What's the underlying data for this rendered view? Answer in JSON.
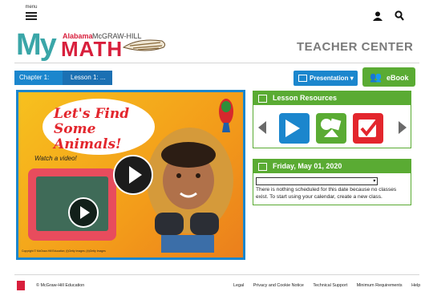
{
  "topbar": {
    "menu_label": "menu",
    "user_icon": "user-icon",
    "search_icon": "search-icon"
  },
  "logo": {
    "my": "My",
    "state": "Alabama",
    "publisher": "McGRAW-HILL",
    "math": "MATH"
  },
  "header": {
    "title": "TEACHER CENTER"
  },
  "breadcrumb": {
    "items": [
      {
        "label": "Chapter 1: A..."
      },
      {
        "label": "Lesson 1: ..."
      }
    ]
  },
  "buttons": {
    "presentation": "Presentation",
    "ebook": "eBook"
  },
  "video": {
    "bubble_text": "Let's Find Some Animals!",
    "watch_text": "Watch a video!",
    "credit": "Copyright © McGraw-Hill Education; (t)Getty Images; (b)Getty Images"
  },
  "lesson_resources": {
    "title": "Lesson Resources",
    "tiles": [
      "presentation-icon",
      "shapes-icon",
      "check-icon"
    ]
  },
  "calendar": {
    "date": "Friday, May 01, 2020",
    "select_value": "",
    "message": "There is nothing scheduled for this date because no classes exist. To start using your calendar, create a new class."
  },
  "footer": {
    "copyright": "© McGraw-Hill Education",
    "links": [
      "Legal",
      "Privacy and Cookie Notice",
      "Technical Support",
      "Minimum Requirements",
      "Help"
    ]
  },
  "colors": {
    "brand_blue": "#1b86cd",
    "brand_green": "#5aab33",
    "brand_red": "#d81f3c",
    "teal": "#3aa6a8"
  }
}
